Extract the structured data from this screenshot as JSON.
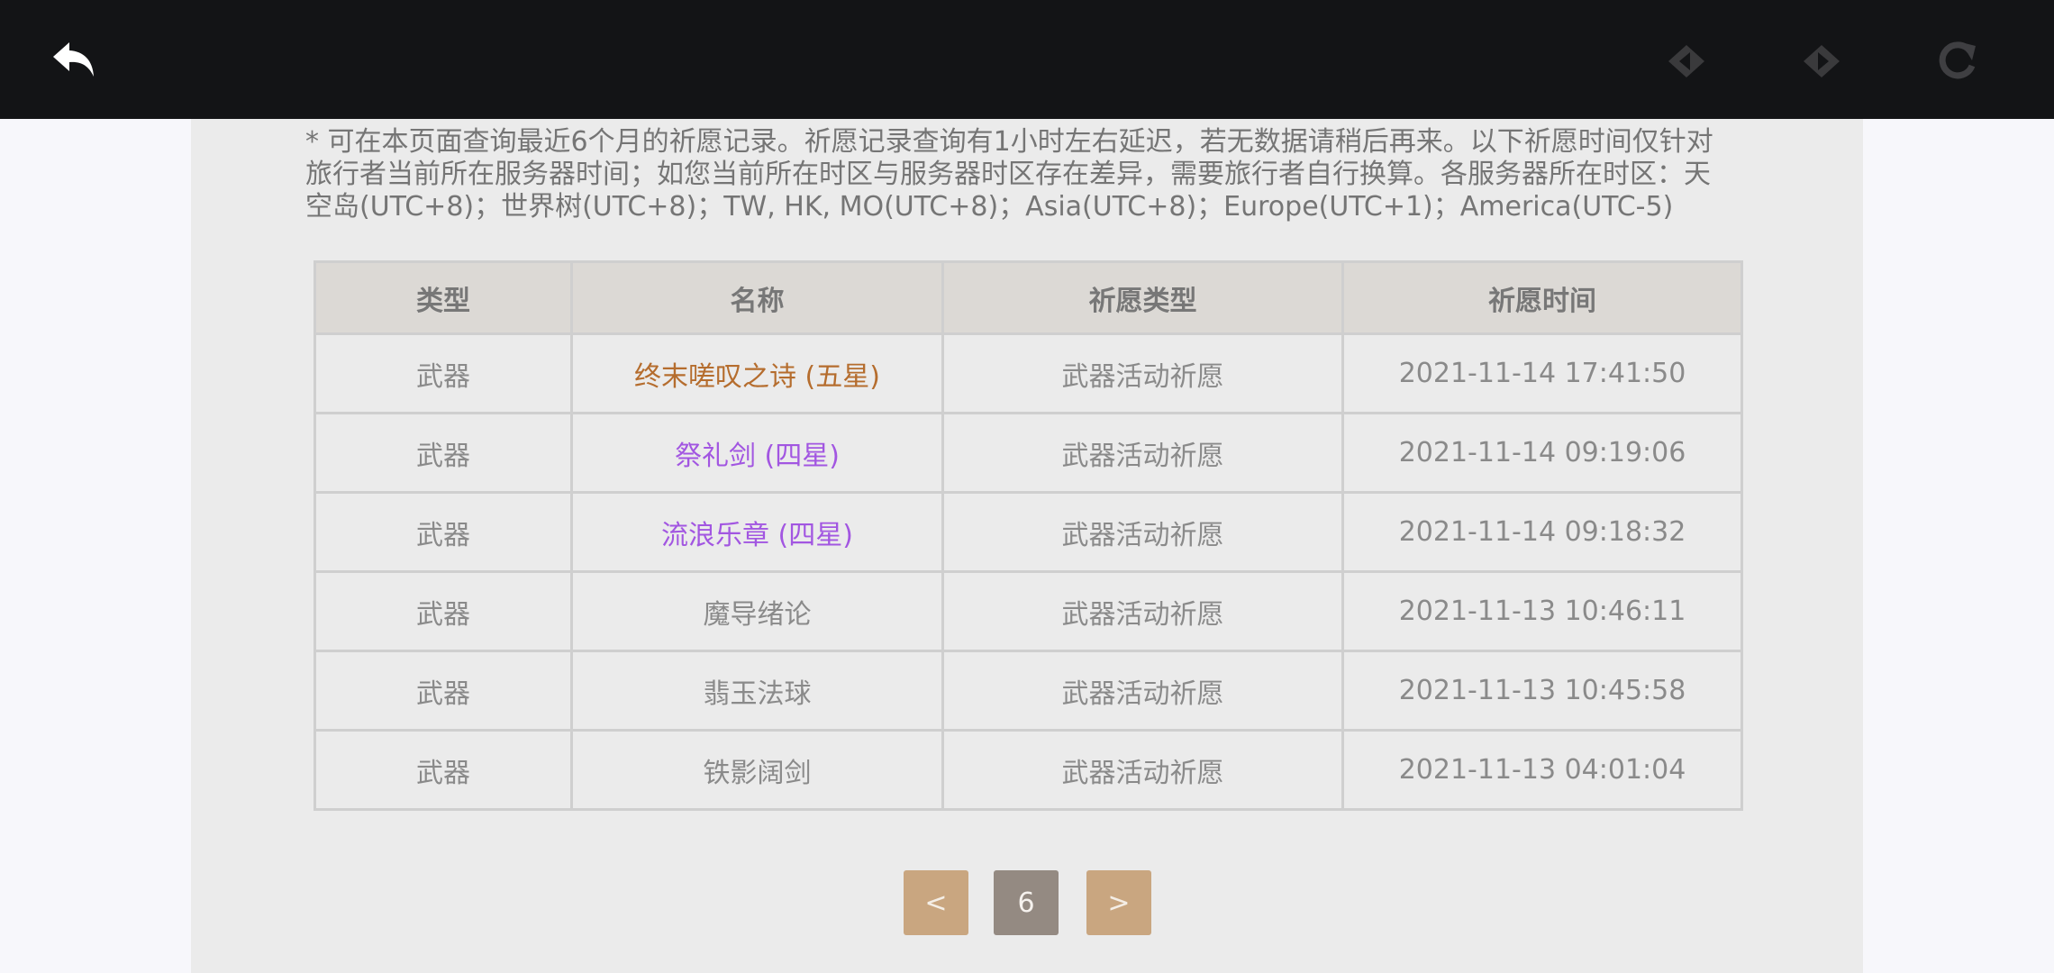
{
  "toolbar": {
    "back_icon": "back-arrow-icon",
    "prev_icon": "prev-page-icon",
    "next_icon": "next-page-icon",
    "reload_icon": "reload-icon"
  },
  "notice": "* 可在本页面查询最近6个月的祈愿记录。祈愿记录查询有1小时左右延迟，若无数据请稍后再来。以下祈愿时间仅针对\n旅行者当前所在服务器时间；如您当前所在时区与服务器时区存在差异，需要旅行者自行换算。各服务器所在时区：天\n空岛(UTC+8)；世界树(UTC+8)；TW, HK, MO(UTC+8)；Asia(UTC+8)；Europe(UTC+1)；America(UTC-5)",
  "table": {
    "headers": [
      "类型",
      "名称",
      "祈愿类型",
      "祈愿时间"
    ],
    "rows": [
      {
        "type": "武器",
        "name": "终末嗟叹之诗 (五星)",
        "rarity": "5",
        "wish_type": "武器活动祈愿",
        "time": "2021-11-14 17:41:50"
      },
      {
        "type": "武器",
        "name": "祭礼剑 (四星)",
        "rarity": "4",
        "wish_type": "武器活动祈愿",
        "time": "2021-11-14 09:19:06"
      },
      {
        "type": "武器",
        "name": "流浪乐章 (四星)",
        "rarity": "4",
        "wish_type": "武器活动祈愿",
        "time": "2021-11-14 09:18:32"
      },
      {
        "type": "武器",
        "name": "魔导绪论",
        "rarity": "3",
        "wish_type": "武器活动祈愿",
        "time": "2021-11-13 10:46:11"
      },
      {
        "type": "武器",
        "name": "翡玉法球",
        "rarity": "3",
        "wish_type": "武器活动祈愿",
        "time": "2021-11-13 10:45:58"
      },
      {
        "type": "武器",
        "name": "铁影阔剑",
        "rarity": "3",
        "wish_type": "武器活动祈愿",
        "time": "2021-11-13 04:01:04"
      }
    ]
  },
  "pagination": {
    "prev_label": "<",
    "current_page": "6",
    "next_label": ">"
  },
  "colors": {
    "five_star": "#b56d2e",
    "four_star": "#a256e1",
    "three_star": "#8a8a8a",
    "pager_button": "#c9a680",
    "pager_current": "#948a82"
  }
}
